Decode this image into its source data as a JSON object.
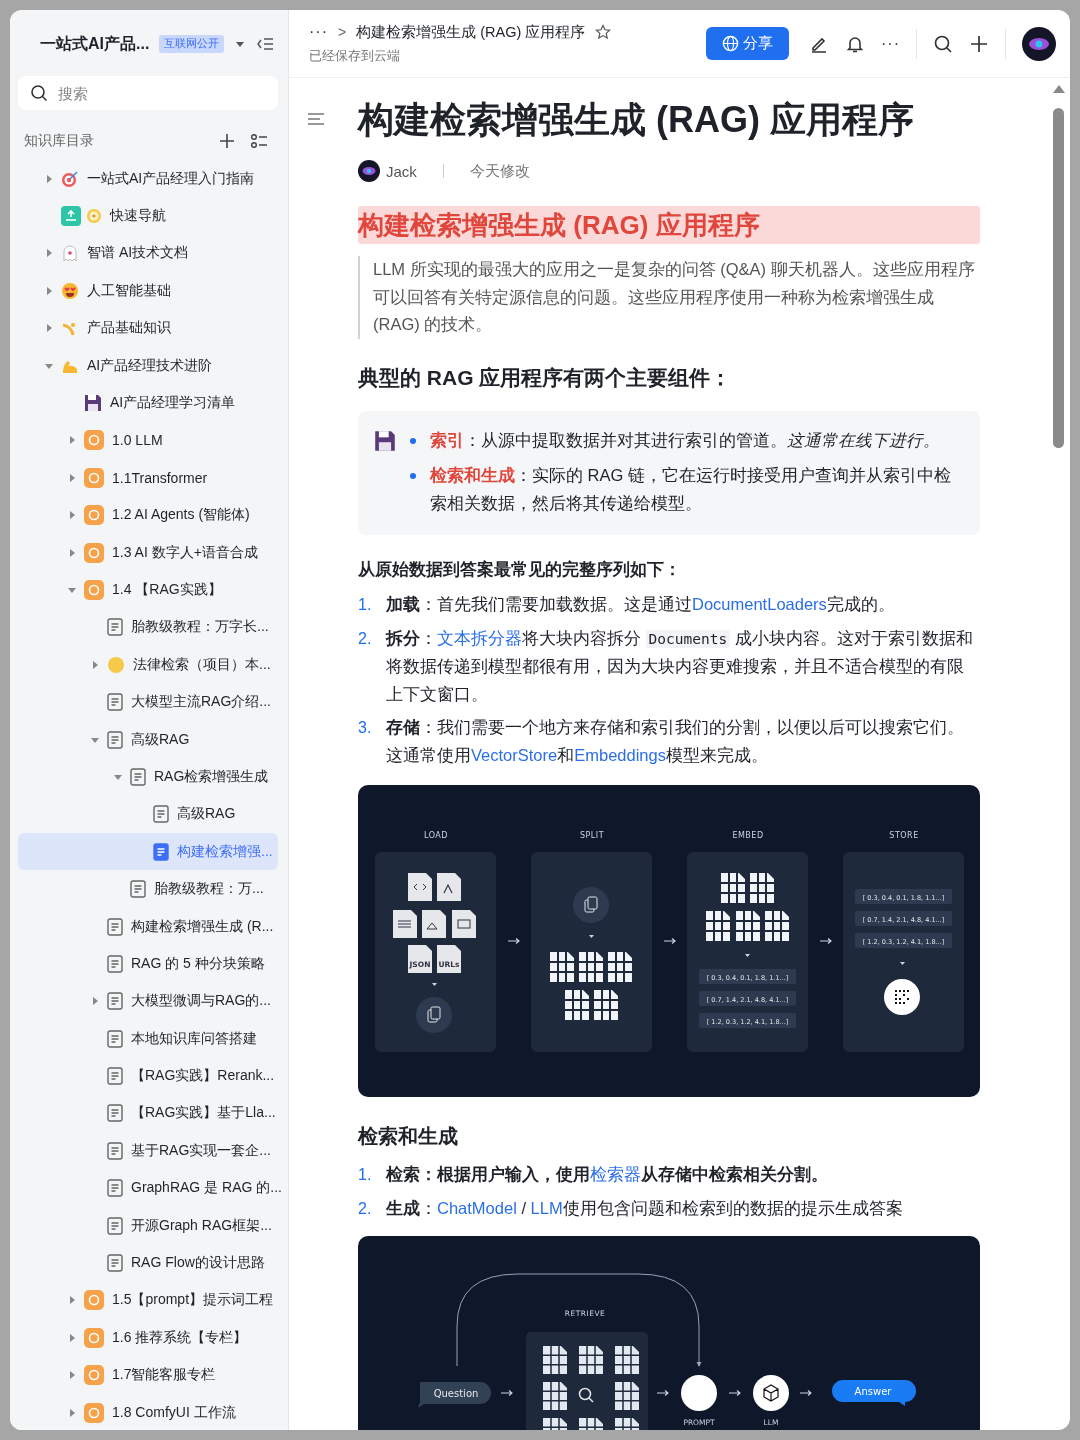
{
  "sidebar": {
    "title": "一站式AI产品...",
    "badge": "互联网公开",
    "search": {
      "placeholder": "搜索"
    },
    "section_title": "知识库目录",
    "tree": [
      {
        "label": "一站式AI产品经理入门指南",
        "kind": "target",
        "expanded": false,
        "selected": false
      },
      {
        "label": "快速导航",
        "kind": "nav",
        "selected": false
      },
      {
        "label": "智谱 AI技术文档",
        "kind": "ghost",
        "expanded": false,
        "selected": false
      },
      {
        "label": "人工智能基础",
        "kind": "emoji",
        "expanded": false,
        "selected": false
      },
      {
        "label": "产品基础知识",
        "kind": "product",
        "expanded": false,
        "selected": false
      },
      {
        "label": "AI产品经理技术进阶",
        "kind": "muscle",
        "expanded": true,
        "selected": false,
        "children": [
          {
            "label": "AI产品经理学习清单",
            "kind": "floppy",
            "selected": false
          },
          {
            "label": "1.0 LLM",
            "kind": "orange",
            "expanded": false,
            "selected": false
          },
          {
            "label": "1.1Transformer",
            "kind": "orange",
            "expanded": false,
            "selected": false
          },
          {
            "label": "1.2 AI Agents (智能体)",
            "kind": "orange",
            "expanded": false,
            "selected": false
          },
          {
            "label": "1.3 AI 数字人+语音合成",
            "kind": "orange",
            "expanded": false,
            "selected": false
          },
          {
            "label": "1.4 【RAG实践】",
            "kind": "orange",
            "expanded": true,
            "selected": false,
            "children": [
              {
                "label": "胎教级教程：万字长...",
                "kind": "doc",
                "selected": false
              },
              {
                "label": "法律检索（项目）本...",
                "kind": "face",
                "expanded": false,
                "selected": false
              },
              {
                "label": "大模型主流RAG介绍...",
                "kind": "doc",
                "selected": false
              },
              {
                "label": "高级RAG",
                "kind": "doc",
                "expanded": true,
                "selected": false,
                "children": [
                  {
                    "label": "RAG检索增强生成",
                    "kind": "doc",
                    "expanded": true,
                    "selected": false,
                    "children": [
                      {
                        "label": "高级RAG",
                        "kind": "doc",
                        "selected": false
                      },
                      {
                        "label": "构建检索增强...",
                        "kind": "doc",
                        "selected": true
                      }
                    ]
                  },
                  {
                    "label": "胎教级教程：万...",
                    "kind": "doc",
                    "selected": false
                  }
                ]
              },
              {
                "label": "构建检索增强生成 (R...",
                "kind": "doc",
                "selected": false
              },
              {
                "label": "RAG 的 5 种分块策略",
                "kind": "doc",
                "selected": false
              },
              {
                "label": "大模型微调与RAG的...",
                "kind": "doc",
                "expanded": false,
                "selected": false
              },
              {
                "label": "本地知识库问答搭建",
                "kind": "doc",
                "selected": false
              },
              {
                "label": "【RAG实践】Rerank...",
                "kind": "doc",
                "selected": false
              },
              {
                "label": "【RAG实践】基于Lla...",
                "kind": "doc",
                "selected": false
              },
              {
                "label": "基于RAG实现一套企...",
                "kind": "doc",
                "selected": false
              },
              {
                "label": "GraphRAG 是 RAG 的...",
                "kind": "doc",
                "selected": false
              },
              {
                "label": "开源Graph RAG框架...",
                "kind": "doc",
                "selected": false
              },
              {
                "label": "RAG Flow的设计思路",
                "kind": "doc",
                "selected": false
              }
            ]
          },
          {
            "label": "1.5【prompt】提示词工程",
            "kind": "orange",
            "expanded": false,
            "selected": false
          },
          {
            "label": "1.6 推荐系统【专栏】",
            "kind": "orange",
            "expanded": false,
            "selected": false
          },
          {
            "label": "1.7智能客服专栏",
            "kind": "orange",
            "expanded": false,
            "selected": false
          },
          {
            "label": "1.8 ComfyUI 工作流",
            "kind": "orange",
            "expanded": false,
            "selected": false
          }
        ]
      }
    ]
  },
  "header": {
    "more": "···",
    "separator": ">",
    "breadcrumb": "构建检索增强生成 (RAG) 应用程序",
    "status": "已经保存到云端",
    "share_button": "分享",
    "more_menu": "···"
  },
  "document": {
    "title": "构建检索增强生成 (RAG) 应用程序",
    "author": "Jack",
    "modified": "今天修改",
    "highlight_heading": "构建检索增强生成 (RAG) 应用程序",
    "quote": "LLM 所实现的最强大的应用之一是复杂的问答 (Q&A) 聊天机器人。这些应用程序可以回答有关特定源信息的问题。这些应用程序使用一种称为检索增强生成 (RAG) 的技术。",
    "components_heading": "典型的 RAG 应用程序有两个主要组件：",
    "callout": [
      "**索引**：从源中提取数据并对其进行索引的管道。*这通常在线下进行。*",
      "**检索和生成**：实际的 RAG 链，它在运行时接受用户查询并从索引中检索相关数据，然后将其传递给模型。"
    ],
    "sequence_heading": "从原始数据到答案最常见的完整序列如下：",
    "steps": [
      {
        "number": "1.",
        "segments": [
          {
            "kind": "bold",
            "text": "加载"
          },
          {
            "kind": "plain",
            "text": "：首先我们需要加载数据。这是通过"
          },
          {
            "kind": "link",
            "text": "DocumentLoaders"
          },
          {
            "kind": "plain",
            "text": "完成的。"
          }
        ]
      },
      {
        "number": "2.",
        "segments": [
          {
            "kind": "bold",
            "text": "拆分"
          },
          {
            "kind": "plain",
            "text": "："
          },
          {
            "kind": "link",
            "text": "文本拆分器"
          },
          {
            "kind": "plain",
            "text": "将大块内容拆分 "
          },
          {
            "kind": "code",
            "text": "Documents"
          },
          {
            "kind": "plain",
            "text": " 成小块内容。这对于索引数据和将数据传递到模型都很有用，因为大块内容更难搜索，并且不适合模型的有限上下文窗口。"
          }
        ]
      },
      {
        "number": "3.",
        "segments": [
          {
            "kind": "bold",
            "text": "存储"
          },
          {
            "kind": "plain",
            "text": "：我们需要一个地方来存储和索引我们的分割，以便以后可以搜索它们。这通常使用"
          },
          {
            "kind": "link",
            "text": "VectorStore"
          },
          {
            "kind": "plain",
            "text": "和"
          },
          {
            "kind": "link",
            "text": "Embeddings"
          },
          {
            "kind": "plain",
            "text": "模型来完成。"
          }
        ]
      }
    ],
    "indexing_diagram": {
      "stages": [
        "LOAD",
        "SPLIT",
        "EMBED",
        "STORE"
      ],
      "file_types": [
        "JSON",
        "URLs"
      ],
      "embed_vectors": [
        "[ 0.3, 0.4, 0.1, 1.8, 1.1...]",
        "[ 0.7, 1.4, 2.1, 4.8, 4.1...]",
        "[ 1.2, 0.3, 1.2, 4.1, 1.8...]"
      ],
      "store_vectors": [
        "[ 0.3, 0.4, 0.1, 1.8, 1.1...]",
        "[ 0.7, 1.4, 2.1, 4.8, 4.1...]",
        "[ 1.2, 0.3, 1.2, 4.1, 1.8...]"
      ]
    },
    "retrieval_heading": "检索和生成",
    "retrieval_steps": [
      {
        "number": "1.",
        "segments": [
          {
            "kind": "bold",
            "text": "检索：根据用户输入，使用"
          },
          {
            "kind": "link",
            "text": "检索器"
          },
          {
            "kind": "bold",
            "text": "从存储中检索相关分割。"
          }
        ]
      },
      {
        "number": "2.",
        "segments": [
          {
            "kind": "bold",
            "text": "生成"
          },
          {
            "kind": "plain",
            "text": "："
          },
          {
            "kind": "link",
            "text": "ChatModel"
          },
          {
            "kind": "plain",
            "text": " / "
          },
          {
            "kind": "link",
            "text": "LLM"
          },
          {
            "kind": "plain",
            "text": "使用包含问题和检索到的数据的提示生成答案"
          }
        ]
      }
    ],
    "retrieval_diagram": {
      "retrieve_label": "RETRIEVE",
      "question": "Question",
      "prompt_label": "PROMPT",
      "llm_label": "LLM",
      "answer": "Answer"
    }
  }
}
